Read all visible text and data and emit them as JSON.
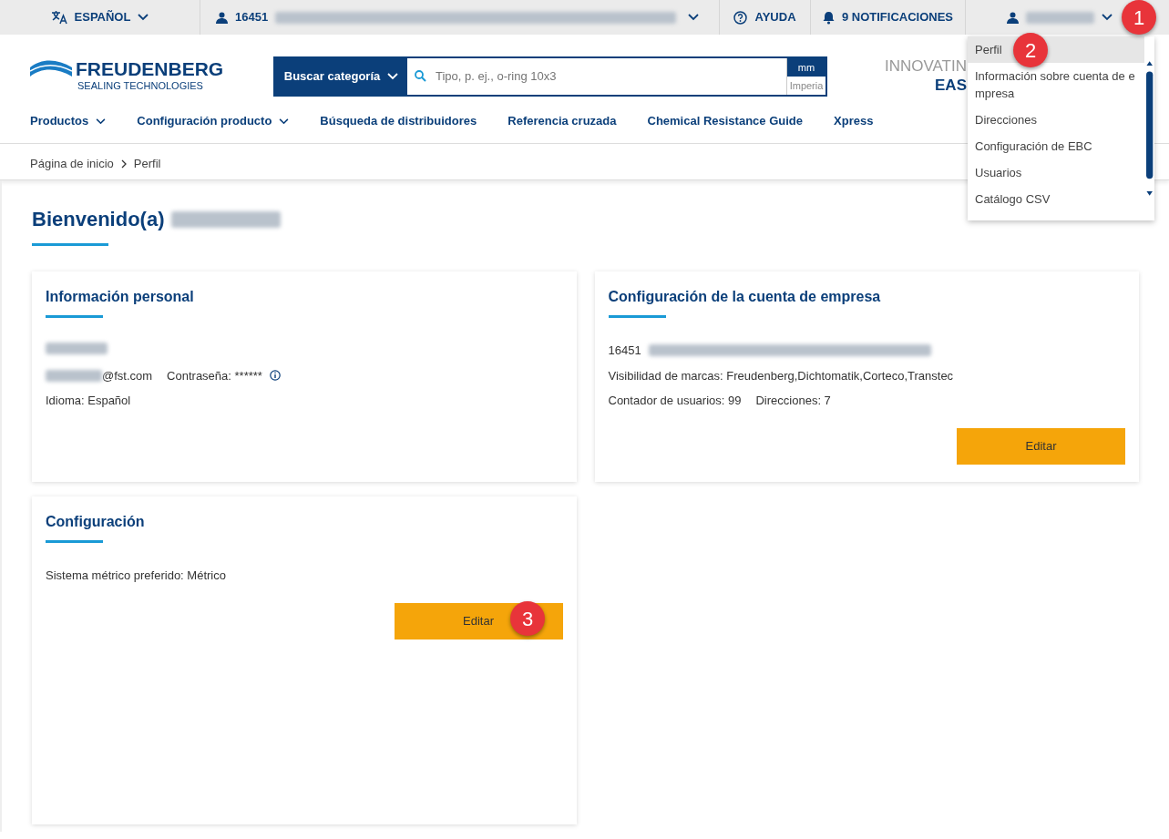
{
  "top_bar": {
    "language": "ESPAÑOL",
    "account_number": "16451",
    "help": "AYUDA",
    "notifications": "9 NOTIFICACIONES"
  },
  "header": {
    "logo": {
      "name": "FREUDENBERG",
      "subtitle": "SEALING TECHNOLOGIES"
    },
    "search": {
      "category": "Buscar categoría",
      "placeholder": "Tipo, p. ej., o-ring 10x3",
      "units": [
        {
          "label": "mm",
          "selected": true
        },
        {
          "label": "Imperia",
          "selected": false
        }
      ]
    },
    "tagline": [
      "INNOVATIN",
      "EAS"
    ]
  },
  "nav": [
    {
      "label": "Productos",
      "dropdown": true
    },
    {
      "label": "Configuración producto",
      "dropdown": true
    },
    {
      "label": "Búsqueda de distribuidores",
      "dropdown": false
    },
    {
      "label": "Referencia cruzada",
      "dropdown": false
    },
    {
      "label": "Chemical Resistance Guide",
      "dropdown": false
    },
    {
      "label": "Xpress",
      "dropdown": false
    }
  ],
  "breadcrumb": [
    "Página de inicio",
    "Perfil"
  ],
  "user_menu": [
    {
      "label": "Perfil",
      "selected": true
    },
    {
      "label": "Información sobre cuenta de e mpresa",
      "selected": false
    },
    {
      "label": "Direcciones",
      "selected": false
    },
    {
      "label": "Configuración de EBC",
      "selected": false
    },
    {
      "label": "Usuarios",
      "selected": false
    },
    {
      "label": "Catálogo CSV",
      "selected": false
    }
  ],
  "welcome": "Bienvenido(a)",
  "personal_card": {
    "title": "Información personal",
    "email_suffix": "@fst.com",
    "password": "Contraseña: ******",
    "language": "Idioma: Español"
  },
  "company_card": {
    "title": "Configuración de la cuenta de empresa",
    "account_number": "16451",
    "lines": [
      "Visibilidad de marcas: Freudenberg,Dichtomatik,Corteco,Transtec"
    ],
    "user_count": "Contador de usuarios: 99",
    "addresses": "Direcciones: 7",
    "button": "Editar"
  },
  "settings_card": {
    "title": "Configuración",
    "line": "Sistema métrico preferido: Métrico",
    "button": "Editar"
  },
  "annotations": [
    {
      "number": "1"
    },
    {
      "number": "2"
    },
    {
      "number": "3"
    }
  ]
}
